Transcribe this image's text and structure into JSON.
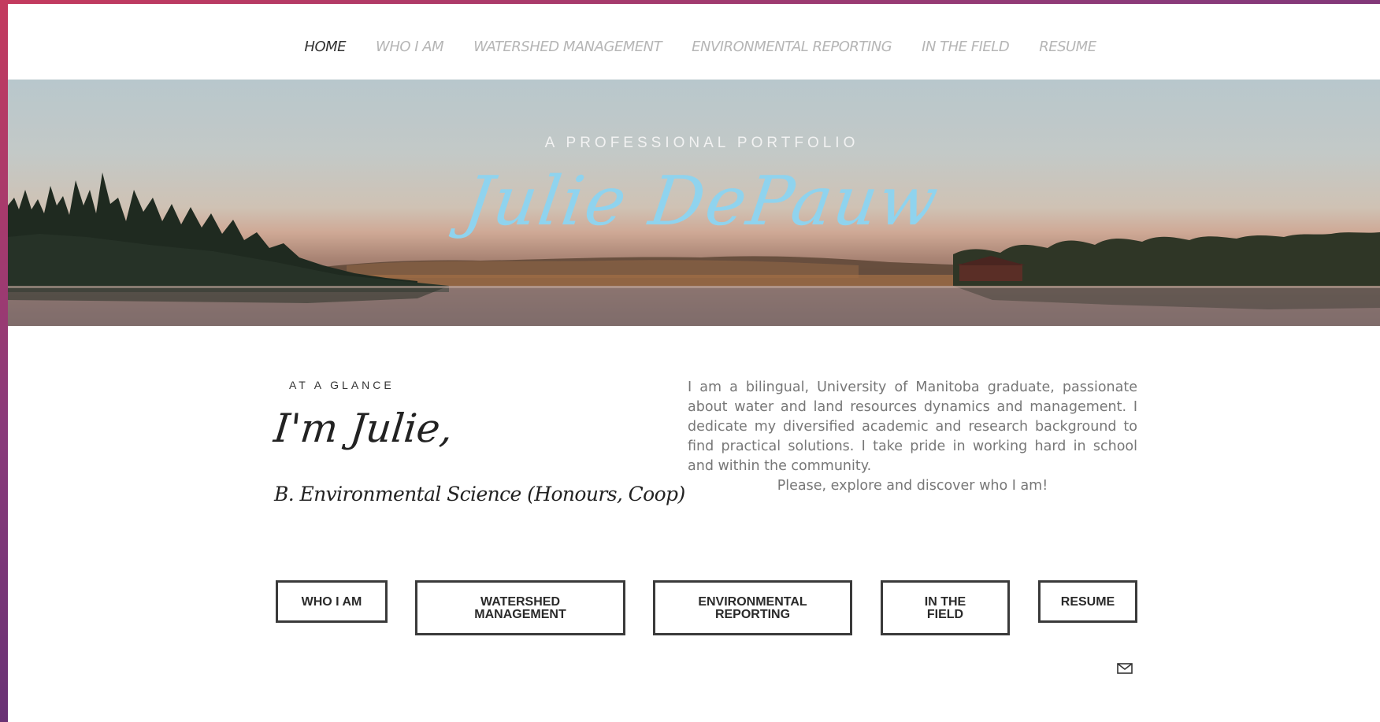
{
  "nav": {
    "items": [
      {
        "label": "HOME",
        "active": true
      },
      {
        "label": "WHO I AM",
        "active": false
      },
      {
        "label": "WATERSHED MANAGEMENT",
        "active": false
      },
      {
        "label": "ENVIRONMENTAL REPORTING",
        "active": false
      },
      {
        "label": "IN THE FIELD",
        "active": false
      },
      {
        "label": "RESUME",
        "active": false
      }
    ]
  },
  "hero": {
    "subtitle": "A PROFESSIONAL PORTFOLIO",
    "title": "Julie DePauw"
  },
  "glance": {
    "label": "AT A GLANCE",
    "title": "I'm Julie,",
    "degree": "B. Environmental Science (Honours, Coop)"
  },
  "intro": {
    "paragraph": "I am a bilingual, University of Manitoba graduate, passionate about water and land resources dynamics and management. I dedicate my diversified academic and research background to find practical solutions. I take pride in working hard in school and within the community.",
    "closing": "Please, explore and discover who I am!"
  },
  "buttons": {
    "who_i_am": "WHO I AM",
    "watershed_line1": "WATERSHED",
    "watershed_line2": "MANAGEMENT",
    "environmental_line1": "ENVIRONMENTAL",
    "environmental_line2": "REPORTING",
    "field_line1": "IN THE",
    "field_line2": "FIELD",
    "resume": "RESUME"
  },
  "icons": {
    "mail": "mail-icon"
  },
  "colors": {
    "title_accent": "#8fd3ee",
    "text_dark": "#222222",
    "text_muted": "#777777",
    "nav_inactive": "#b6b6b6"
  }
}
